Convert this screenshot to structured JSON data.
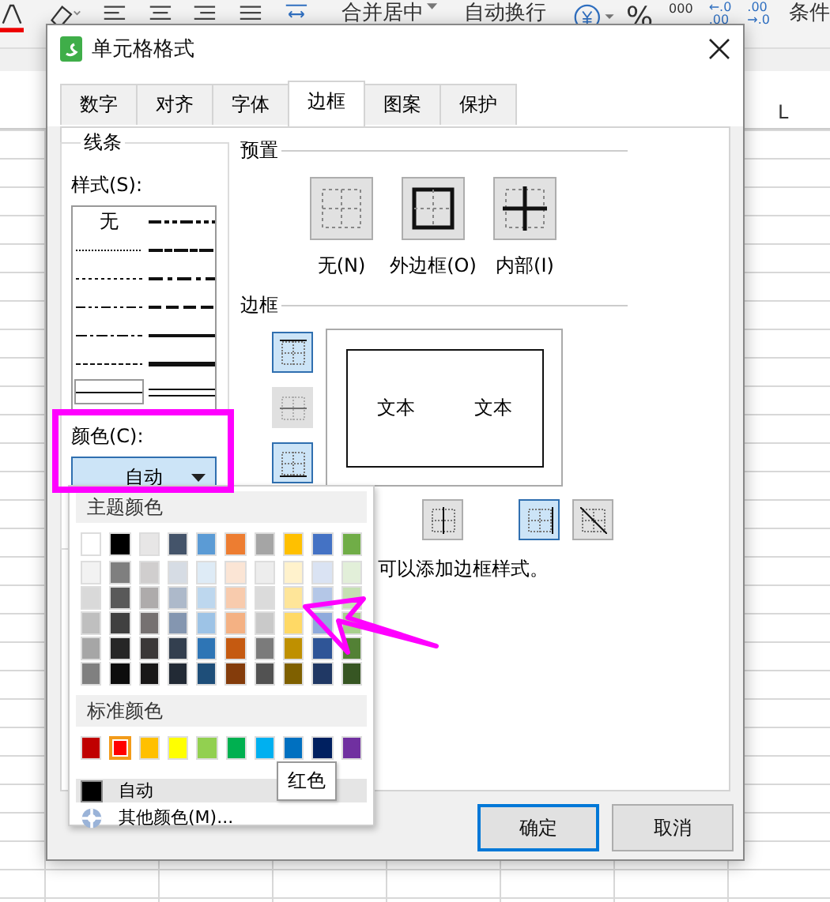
{
  "toolbar": {
    "merge_label": "合并居中",
    "wrap_label": "自动换行",
    "percent": "%",
    "thousands": "000",
    "decimal_increase": [
      "←.0",
      ".00"
    ],
    "decimal_decrease": [
      ".00",
      "→.0"
    ],
    "conditional_label": "条件"
  },
  "sheet": {
    "column_header": "L"
  },
  "dialog": {
    "title": "单元格格式",
    "tabs": [
      {
        "label": "数字",
        "selected": false
      },
      {
        "label": "对齐",
        "selected": false
      },
      {
        "label": "字体",
        "selected": false
      },
      {
        "label": "边框",
        "selected": true
      },
      {
        "label": "图案",
        "selected": false
      },
      {
        "label": "保护",
        "selected": false
      }
    ],
    "line_group": {
      "title": "线条",
      "style_label": "样式(S):",
      "styles": [
        {
          "kind": "none",
          "label": "无",
          "selected": false
        },
        {
          "kind": "medium-dashdotdot",
          "selected": false
        },
        {
          "kind": "hair",
          "selected": false
        },
        {
          "kind": "slanted",
          "selected": false
        },
        {
          "kind": "dotted",
          "selected": false
        },
        {
          "kind": "medium-dashdot",
          "selected": false
        },
        {
          "kind": "dashdotdot",
          "selected": false
        },
        {
          "kind": "medium-dashed",
          "selected": false
        },
        {
          "kind": "dashdot",
          "selected": false
        },
        {
          "kind": "medium",
          "selected": false
        },
        {
          "kind": "dashed",
          "selected": false
        },
        {
          "kind": "thick",
          "selected": false
        },
        {
          "kind": "thin",
          "selected": true
        },
        {
          "kind": "double",
          "selected": false
        }
      ],
      "color_label": "颜色(C):",
      "color_value": "自动"
    },
    "preset": {
      "title": "预置",
      "buttons": [
        {
          "kind": "none",
          "label": "无(N)"
        },
        {
          "kind": "outline",
          "label": "外边框(O)"
        },
        {
          "kind": "inside",
          "label": "内部(I)"
        }
      ]
    },
    "border": {
      "title": "边框",
      "preview_texts": [
        "文本",
        "文本"
      ],
      "side_buttons": [
        {
          "kind": "top",
          "selected": true,
          "disabled": false
        },
        {
          "kind": "middle",
          "disabled": true
        },
        {
          "kind": "bottom",
          "selected": true,
          "disabled": false
        }
      ],
      "bottom_buttons": [
        {
          "kind": "center",
          "selected": false
        },
        {
          "kind": "right",
          "selected": true
        },
        {
          "kind": "diagonal",
          "selected": false
        }
      ]
    },
    "hint_parts": [
      "可以添加边框样式。"
    ],
    "buttons": [
      {
        "label": "确定",
        "focused": true
      },
      {
        "label": "取消",
        "focused": false
      }
    ]
  },
  "color_popup": {
    "theme_title": "主题颜色",
    "theme_colors": [
      {
        "color": "#ffffff"
      },
      {
        "color": "#000000"
      },
      {
        "color": "#e7e6e6"
      },
      {
        "color": "#44546a"
      },
      {
        "color": "#5b9bd5"
      },
      {
        "color": "#ed7d31"
      },
      {
        "color": "#a5a5a5"
      },
      {
        "color": "#ffc000"
      },
      {
        "color": "#4472c4"
      },
      {
        "color": "#70ad47"
      }
    ],
    "shades": [
      [
        {
          "color": "#f2f2f2"
        },
        {
          "color": "#7f7f7f"
        },
        {
          "color": "#d0cece"
        },
        {
          "color": "#d6dce4"
        },
        {
          "color": "#deebf6"
        },
        {
          "color": "#fbe5d5"
        },
        {
          "color": "#ededed"
        },
        {
          "color": "#fff2cc"
        },
        {
          "color": "#dae3f3"
        },
        {
          "color": "#e2efd9"
        }
      ],
      [
        {
          "color": "#d9d9d9"
        },
        {
          "color": "#595959"
        },
        {
          "color": "#aeabab"
        },
        {
          "color": "#adb9ca"
        },
        {
          "color": "#bdd7ee"
        },
        {
          "color": "#f8cbad"
        },
        {
          "color": "#dbdbdb"
        },
        {
          "color": "#fee599"
        },
        {
          "color": "#b4c7e7"
        },
        {
          "color": "#c5e0b3"
        }
      ],
      [
        {
          "color": "#bfbfbf"
        },
        {
          "color": "#404040"
        },
        {
          "color": "#767171"
        },
        {
          "color": "#8496b0"
        },
        {
          "color": "#9dc3e6"
        },
        {
          "color": "#f4b183"
        },
        {
          "color": "#c9c9c9"
        },
        {
          "color": "#ffd965"
        },
        {
          "color": "#8faadc"
        },
        {
          "color": "#a8d08d"
        }
      ],
      [
        {
          "color": "#a6a6a6"
        },
        {
          "color": "#262626"
        },
        {
          "color": "#3b3838"
        },
        {
          "color": "#333f4f"
        },
        {
          "color": "#2e75b5"
        },
        {
          "color": "#c55a11"
        },
        {
          "color": "#7b7b7b"
        },
        {
          "color": "#bf9000"
        },
        {
          "color": "#2f5597"
        },
        {
          "color": "#538135"
        }
      ],
      [
        {
          "color": "#808080"
        },
        {
          "color": "#0d0d0d"
        },
        {
          "color": "#181717"
        },
        {
          "color": "#222a35"
        },
        {
          "color": "#1e4e79"
        },
        {
          "color": "#843c0b"
        },
        {
          "color": "#525252"
        },
        {
          "color": "#7f6000"
        },
        {
          "color": "#203864"
        },
        {
          "color": "#375623"
        }
      ]
    ],
    "standard_title": "标准颜色",
    "standard_colors": [
      {
        "color": "#c00000",
        "selected": false
      },
      {
        "color": "#ff0000",
        "selected": true
      },
      {
        "color": "#ffc000",
        "selected": false
      },
      {
        "color": "#ffff00",
        "selected": false
      },
      {
        "color": "#92d050",
        "selected": false
      },
      {
        "color": "#00b050",
        "selected": false
      },
      {
        "color": "#00b0f0",
        "selected": false
      },
      {
        "color": "#0070c0",
        "selected": false
      },
      {
        "color": "#002060",
        "selected": false
      },
      {
        "color": "#7030a0",
        "selected": false
      }
    ],
    "menu": [
      {
        "kind": "auto",
        "label": "自动",
        "hovered": true
      },
      {
        "kind": "more",
        "label": "其他颜色(M)...",
        "hovered": false
      }
    ],
    "tooltip": "红色"
  }
}
